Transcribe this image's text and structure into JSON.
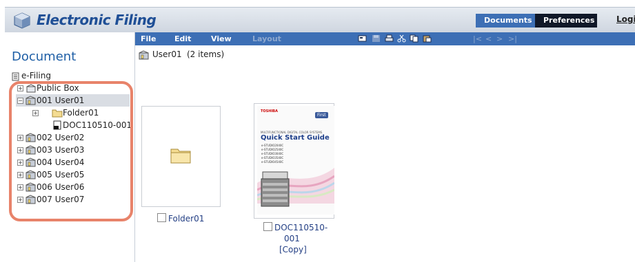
{
  "header": {
    "title": "Electronic Filing",
    "tabs": [
      {
        "label": "Documents",
        "active": true
      },
      {
        "label": "Preferences",
        "active": false
      }
    ],
    "login_label": "Logi",
    "accent_color": "#3d6fb5"
  },
  "sidebar": {
    "heading": "Document",
    "root_label": "e-Filing",
    "tree": [
      {
        "label": "Public Box",
        "icon": "public-box-icon",
        "level": 0,
        "expander": "+"
      },
      {
        "label": "001 User01",
        "icon": "user-box-icon",
        "level": 0,
        "expander": "−",
        "selected": true
      },
      {
        "label": "Folder01",
        "icon": "folder-icon",
        "level": 1,
        "expander": "+"
      },
      {
        "label": "DOC110510-001",
        "icon": "document-icon",
        "level": 1,
        "expander": ""
      },
      {
        "label": "002 User02",
        "icon": "user-box-icon",
        "level": 0,
        "expander": "+"
      },
      {
        "label": "003 User03",
        "icon": "user-box-icon",
        "level": 0,
        "expander": "+"
      },
      {
        "label": "004 User04",
        "icon": "user-box-icon",
        "level": 0,
        "expander": "+"
      },
      {
        "label": "005 User05",
        "icon": "user-box-icon",
        "level": 0,
        "expander": "+"
      },
      {
        "label": "006 User06",
        "icon": "user-box-icon",
        "level": 0,
        "expander": "+"
      },
      {
        "label": "007 User07",
        "icon": "user-box-icon",
        "level": 0,
        "expander": "+"
      }
    ],
    "highlight_color": "#e8836a"
  },
  "toolbar": {
    "menus": [
      {
        "label": "File",
        "enabled": true
      },
      {
        "label": "Edit",
        "enabled": true
      },
      {
        "label": "View",
        "enabled": true
      },
      {
        "label": "Layout",
        "enabled": false
      }
    ],
    "tools": [
      "properties-icon",
      "save-icon",
      "print-icon",
      "cut-icon",
      "copy-icon",
      "paste-icon"
    ],
    "pager": [
      "|<",
      "<",
      ">",
      ">|"
    ]
  },
  "content": {
    "location": "User01",
    "item_count": "(2 items)",
    "items": [
      {
        "name": "Folder01",
        "type": "folder"
      },
      {
        "name_lines": [
          "DOC110510-",
          "001",
          "[Copy]"
        ],
        "type": "document"
      }
    ],
    "thumbnail": {
      "brand": "TOSHIBA",
      "badge": "First",
      "series": "MULTIFUNCTIONAL DIGITAL COLOR SYSTEMS",
      "title": "Quick Start Guide",
      "models": [
        "e-STUDIO2040C",
        "e-STUDIO2540C",
        "e-STUDIO3040C",
        "e-STUDIO3540C",
        "e-STUDIO4540C"
      ]
    }
  }
}
